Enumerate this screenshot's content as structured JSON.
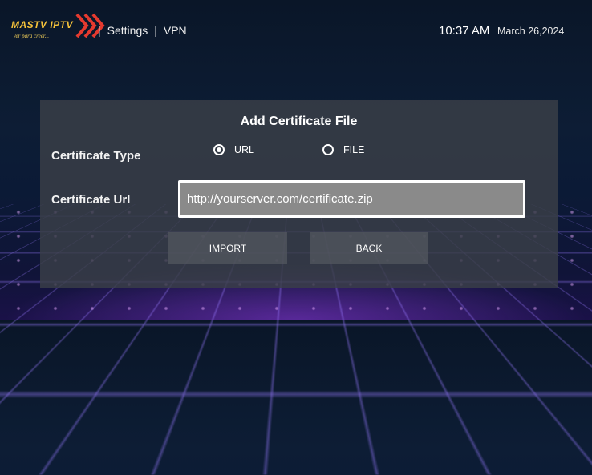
{
  "header": {
    "logo_text": "MASTV IPTV",
    "logo_tagline": "Ver para creer...",
    "breadcrumb": [
      "Settings",
      "VPN"
    ],
    "separator": "|",
    "time": "10:37 AM",
    "date": "March 26,2024"
  },
  "dialog": {
    "title": "Add Certificate File",
    "certificate_type_label": "Certificate Type",
    "certificate_url_label": "Certificate Url",
    "options": [
      {
        "label": "URL",
        "selected": true
      },
      {
        "label": "FILE",
        "selected": false
      }
    ],
    "url_value": "http://yourserver.com/certificate.zip",
    "import_label": "IMPORT",
    "back_label": "BACK"
  },
  "colors": {
    "logo": "#f3c13a",
    "logo_arrows": "#e53a2f",
    "panel": "#3a4048"
  }
}
